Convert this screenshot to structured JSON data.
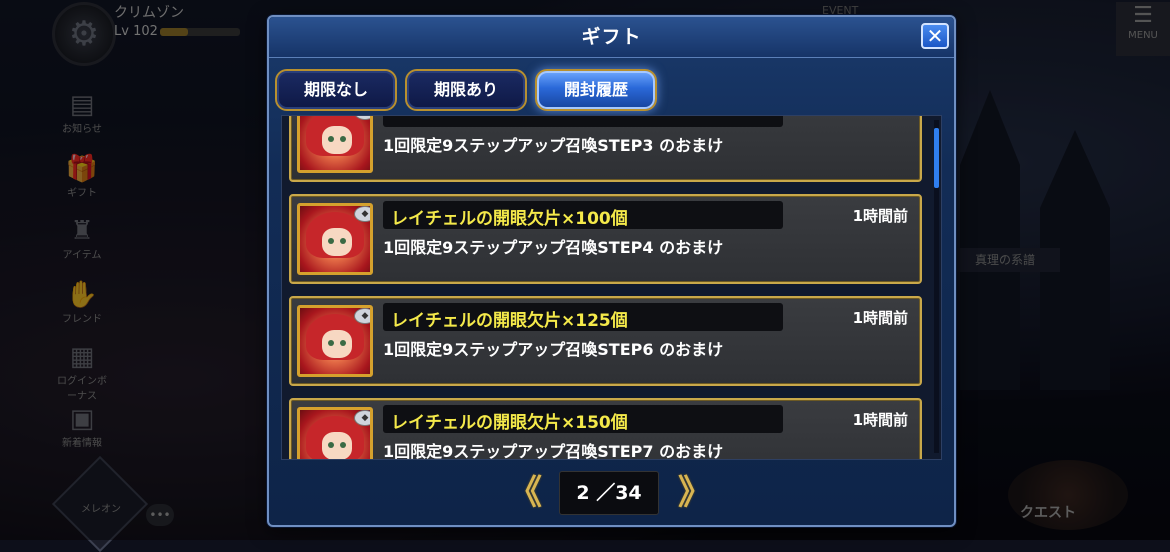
{
  "background": {
    "player_name": "クリムゾン",
    "player_level": "Lv 102",
    "event_label": "EVENT",
    "menu_label": "MENU",
    "quest_label": "クエスト",
    "side_banner": "真理の系譜",
    "left_menu": [
      "お知らせ",
      "ギフト",
      "アイテム",
      "フレンド",
      "ログインボーナス",
      "新着情報"
    ],
    "bottom_left_label": "メレオン"
  },
  "dialog": {
    "title": "ギフト",
    "close_symbol": "✕",
    "tabs": [
      {
        "label": "期限なし",
        "active": false
      },
      {
        "label": "期限あり",
        "active": false
      },
      {
        "label": "開封履歴",
        "active": true
      }
    ]
  },
  "gifts": [
    {
      "name": "",
      "desc": "1回限定9ステップアップ召喚STEP3 のおまけ",
      "time": ""
    },
    {
      "name": "レイチェルの開眼欠片×100個",
      "desc": "1回限定9ステップアップ召喚STEP4 のおまけ",
      "time": "1時間前"
    },
    {
      "name": "レイチェルの開眼欠片×125個",
      "desc": "1回限定9ステップアップ召喚STEP6 のおまけ",
      "time": "1時間前"
    },
    {
      "name": "レイチェルの開眼欠片×150個",
      "desc": "1回限定9ステップアップ召喚STEP7 のおまけ",
      "time": "1時間前"
    }
  ],
  "pager": {
    "text": "2 ／34",
    "prev_symbol": "《",
    "next_symbol": "》"
  },
  "colors": {
    "dialog_bg": "#122c56",
    "tab_active": "#2a68d8",
    "gold_border": "#c9a84a",
    "gift_name": "#f4e94a"
  }
}
